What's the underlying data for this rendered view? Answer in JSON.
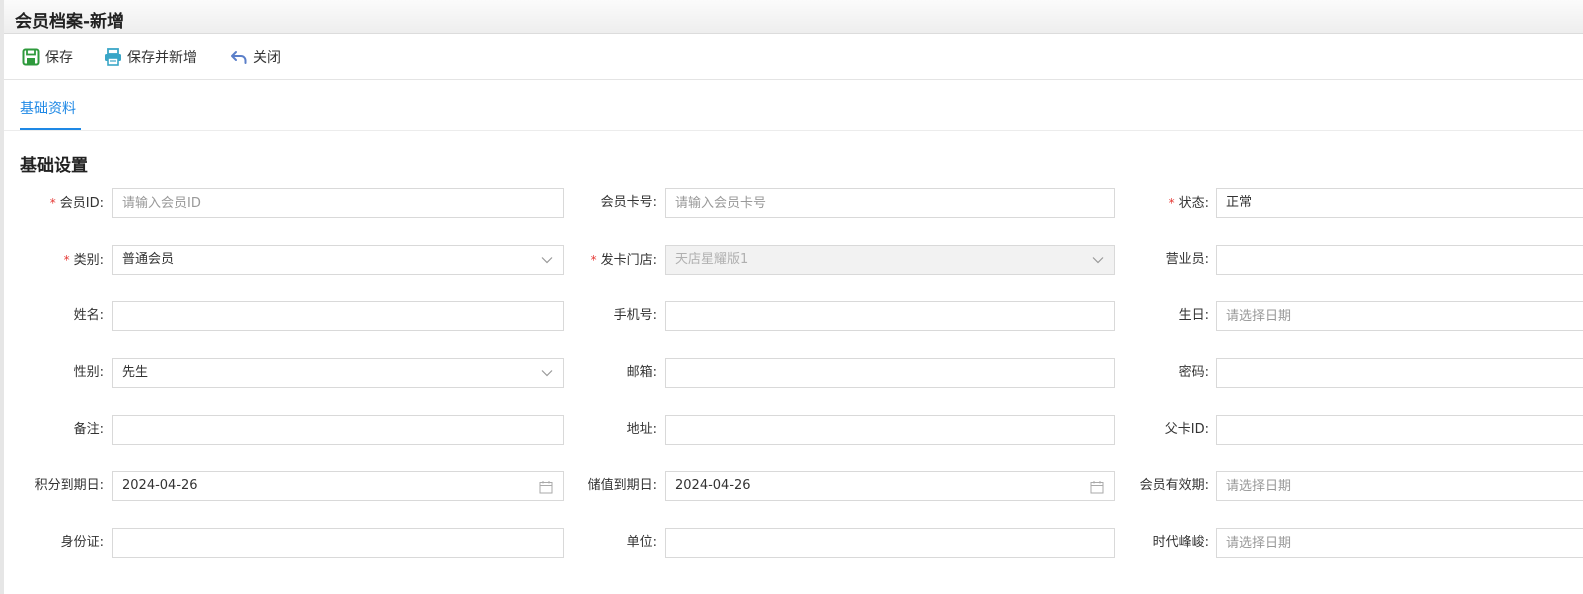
{
  "window": {
    "title": "会员档案-新增"
  },
  "toolbar": {
    "save": "保存",
    "save_new": "保存并新增",
    "close": "关闭"
  },
  "tabs": [
    {
      "label": "基础资料"
    }
  ],
  "section": {
    "title": "基础设置"
  },
  "fields": {
    "member_id": {
      "label": "会员ID:",
      "placeholder": "请输入会员ID"
    },
    "card_no": {
      "label": "会员卡号:",
      "placeholder": "请输入会员卡号"
    },
    "status": {
      "label": "状态:",
      "value": "正常"
    },
    "category": {
      "label": "类别:",
      "value": "普通会员"
    },
    "issue_store": {
      "label": "发卡门店:",
      "value": "天店星耀版1"
    },
    "salesperson": {
      "label": "营业员:",
      "value": ""
    },
    "name": {
      "label": "姓名:",
      "value": ""
    },
    "mobile": {
      "label": "手机号:",
      "value": ""
    },
    "birthday": {
      "label": "生日:",
      "placeholder": "请选择日期"
    },
    "gender": {
      "label": "性别:",
      "value": "先生"
    },
    "email": {
      "label": "邮箱:",
      "value": ""
    },
    "password": {
      "label": "密码:",
      "value": ""
    },
    "remark": {
      "label": "备注:",
      "value": ""
    },
    "address": {
      "label": "地址:",
      "value": ""
    },
    "parent_card": {
      "label": "父卡ID:",
      "value": ""
    },
    "points_expiry": {
      "label": "积分到期日:",
      "value": "2024-04-26"
    },
    "stored_expiry": {
      "label": "储值到期日:",
      "value": "2024-04-26"
    },
    "member_valid": {
      "label": "会员有效期:",
      "placeholder": "请选择日期"
    },
    "id_card": {
      "label": "身份证:",
      "value": ""
    },
    "company": {
      "label": "单位:",
      "value": ""
    },
    "era_peak": {
      "label": "时代峰峻:",
      "placeholder": "请选择日期"
    }
  },
  "colors": {
    "accent": "#1e88e5",
    "required": "#e53935",
    "save_icon": "#2e9a3c",
    "print_icon": "#3aa6c7",
    "close_icon": "#5b7fc9"
  }
}
